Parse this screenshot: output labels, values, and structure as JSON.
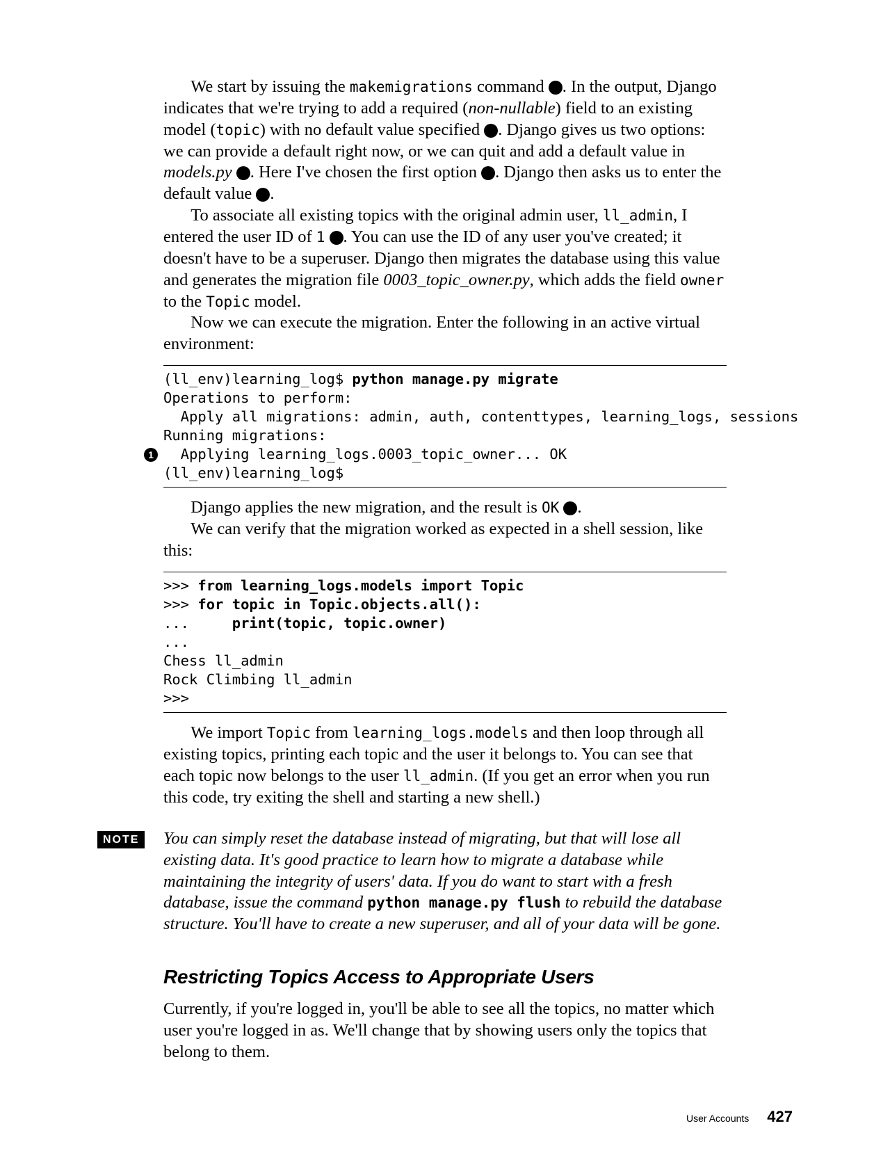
{
  "para1": {
    "t1": "We start by issuing the ",
    "code1": "makemigrations",
    "t2": " command ",
    "m1": "1",
    "t3": ". In the output, Django indicates that we're trying to add a required (",
    "i1": "non-nullable",
    "t4": ") field to an existing model (",
    "code2": "topic",
    "t5": ") with no default value specified ",
    "m2": "2",
    "t6": ". Django gives us two options: we can provide a default right now, or we can quit and add a default value in ",
    "i2": "models.py",
    "t7": " ",
    "m3": "3",
    "t8": ". Here I've chosen the first option ",
    "m4": "4",
    "t9": ". Django then asks us to enter the default value ",
    "m5": "5",
    "t10": "."
  },
  "para2": {
    "t1": "To associate all existing topics with the original admin user, ",
    "code1": "ll_admin",
    "t2": ", I entered the user ID of ",
    "code2": "1",
    "t3": " ",
    "m6": "6",
    "t4": ". You can use the ID of any user you've created; it doesn't have to be a superuser. Django then migrates the database using this value and generates the migration file ",
    "i1": "0003_topic_owner.py",
    "t5": ", which adds the field ",
    "code3": "owner",
    "t6": " to the ",
    "code4": "Topic",
    "t7": " model."
  },
  "para3": "Now we can execute the migration. Enter the following in an active virtual environment:",
  "code1": {
    "l1": "(ll_env)learning_log$ ",
    "l1b": "python manage.py migrate",
    "l2": "Operations to perform:",
    "l3": "  Apply all migrations: admin, auth, contenttypes, learning_logs, sessions",
    "l4": "Running migrations:",
    "marker": "1",
    "l5": "  Applying learning_logs.0003_topic_owner... OK",
    "l6": "(ll_env)learning_log$"
  },
  "para4": {
    "t1": "Django applies the new migration, and the result is ",
    "code1": "OK",
    "t2": " ",
    "m1": "1",
    "t3": "."
  },
  "para5": "We can verify that the migration worked as expected in a shell session, like this:",
  "code2": {
    "l1a": ">>> ",
    "l1b": "from learning_logs.models import Topic",
    "l2a": ">>> ",
    "l2b": "for topic in Topic.objects.all():",
    "l3a": "...     ",
    "l3b": "print(topic, topic.owner)",
    "l4": "...",
    "l5": "Chess ll_admin",
    "l6": "Rock Climbing ll_admin",
    "l7": ">>>"
  },
  "para6": {
    "t1": "We import ",
    "code1": "Topic",
    "t2": " from ",
    "code2": "learning_logs.models",
    "t3": " and then loop through all existing topics, printing each topic and the user it belongs to. You can see that each topic now belongs to the user ",
    "code3": "ll_admin",
    "t4": ". (If you get an error when you run this code, try exiting the shell and starting a new shell.)"
  },
  "note": {
    "label": "NOTE",
    "t1": "You can simply reset the database instead of migrating, but that will lose all existing data. It's good practice to learn how to migrate a database while maintaining the integrity of users' data. If you do want to start with a fresh database, issue the command ",
    "code": "python manage.py flush",
    "t2": " to rebuild the database structure. You'll have to create a new superuser, and all of your data will be gone."
  },
  "section": "Restricting Topics Access to Appropriate Users",
  "para7": "Currently, if you're logged in, you'll be able to see all the topics, no matter which user you're logged in as. We'll change that by showing users only the topics that belong to them.",
  "footer": {
    "chapter": "User Accounts",
    "page": "427"
  }
}
